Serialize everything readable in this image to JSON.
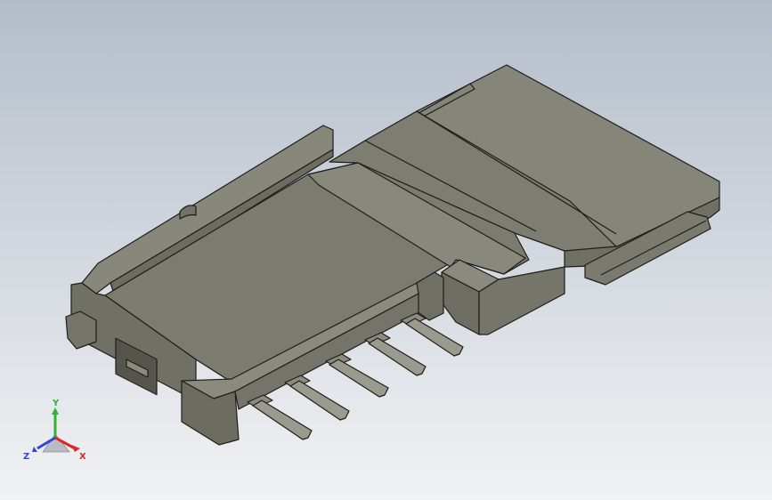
{
  "viewport": {
    "background_top": "#b7c0cc",
    "background_bottom": "#f0f2f5",
    "model_color": "#7f7f73",
    "edge_color": "#1e1e1a"
  },
  "triad": {
    "x_label": "X",
    "y_label": "Y",
    "z_label": "Z",
    "x_color": "#e0252b",
    "y_color": "#2fb13a",
    "z_color": "#2f46d8"
  }
}
